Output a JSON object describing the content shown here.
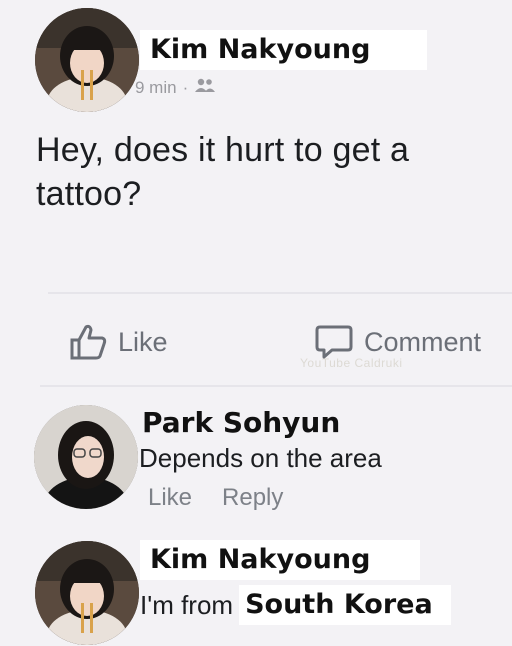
{
  "post": {
    "author": "Kim Nakyoung",
    "time": "9 min",
    "audience_icon": "friends-icon",
    "text": "Hey, does it hurt to get a tattoo?",
    "text_line1": "Hey, does it hurt to get a",
    "text_line2": "tattoo?"
  },
  "actions": {
    "like_label": "Like",
    "comment_label": "Comment",
    "watermark": "YouTube Caldruki"
  },
  "comments": [
    {
      "author": "Park Sohyun",
      "text": "Depends on the area",
      "like_label": "Like",
      "reply_label": "Reply"
    },
    {
      "author": "Kim Nakyoung",
      "text_prefix": "I'm from",
      "text_suffix": "South Korea"
    }
  ],
  "colors": {
    "background": "#f3f2f5",
    "text": "#1c1e21",
    "muted": "#7d8188"
  }
}
